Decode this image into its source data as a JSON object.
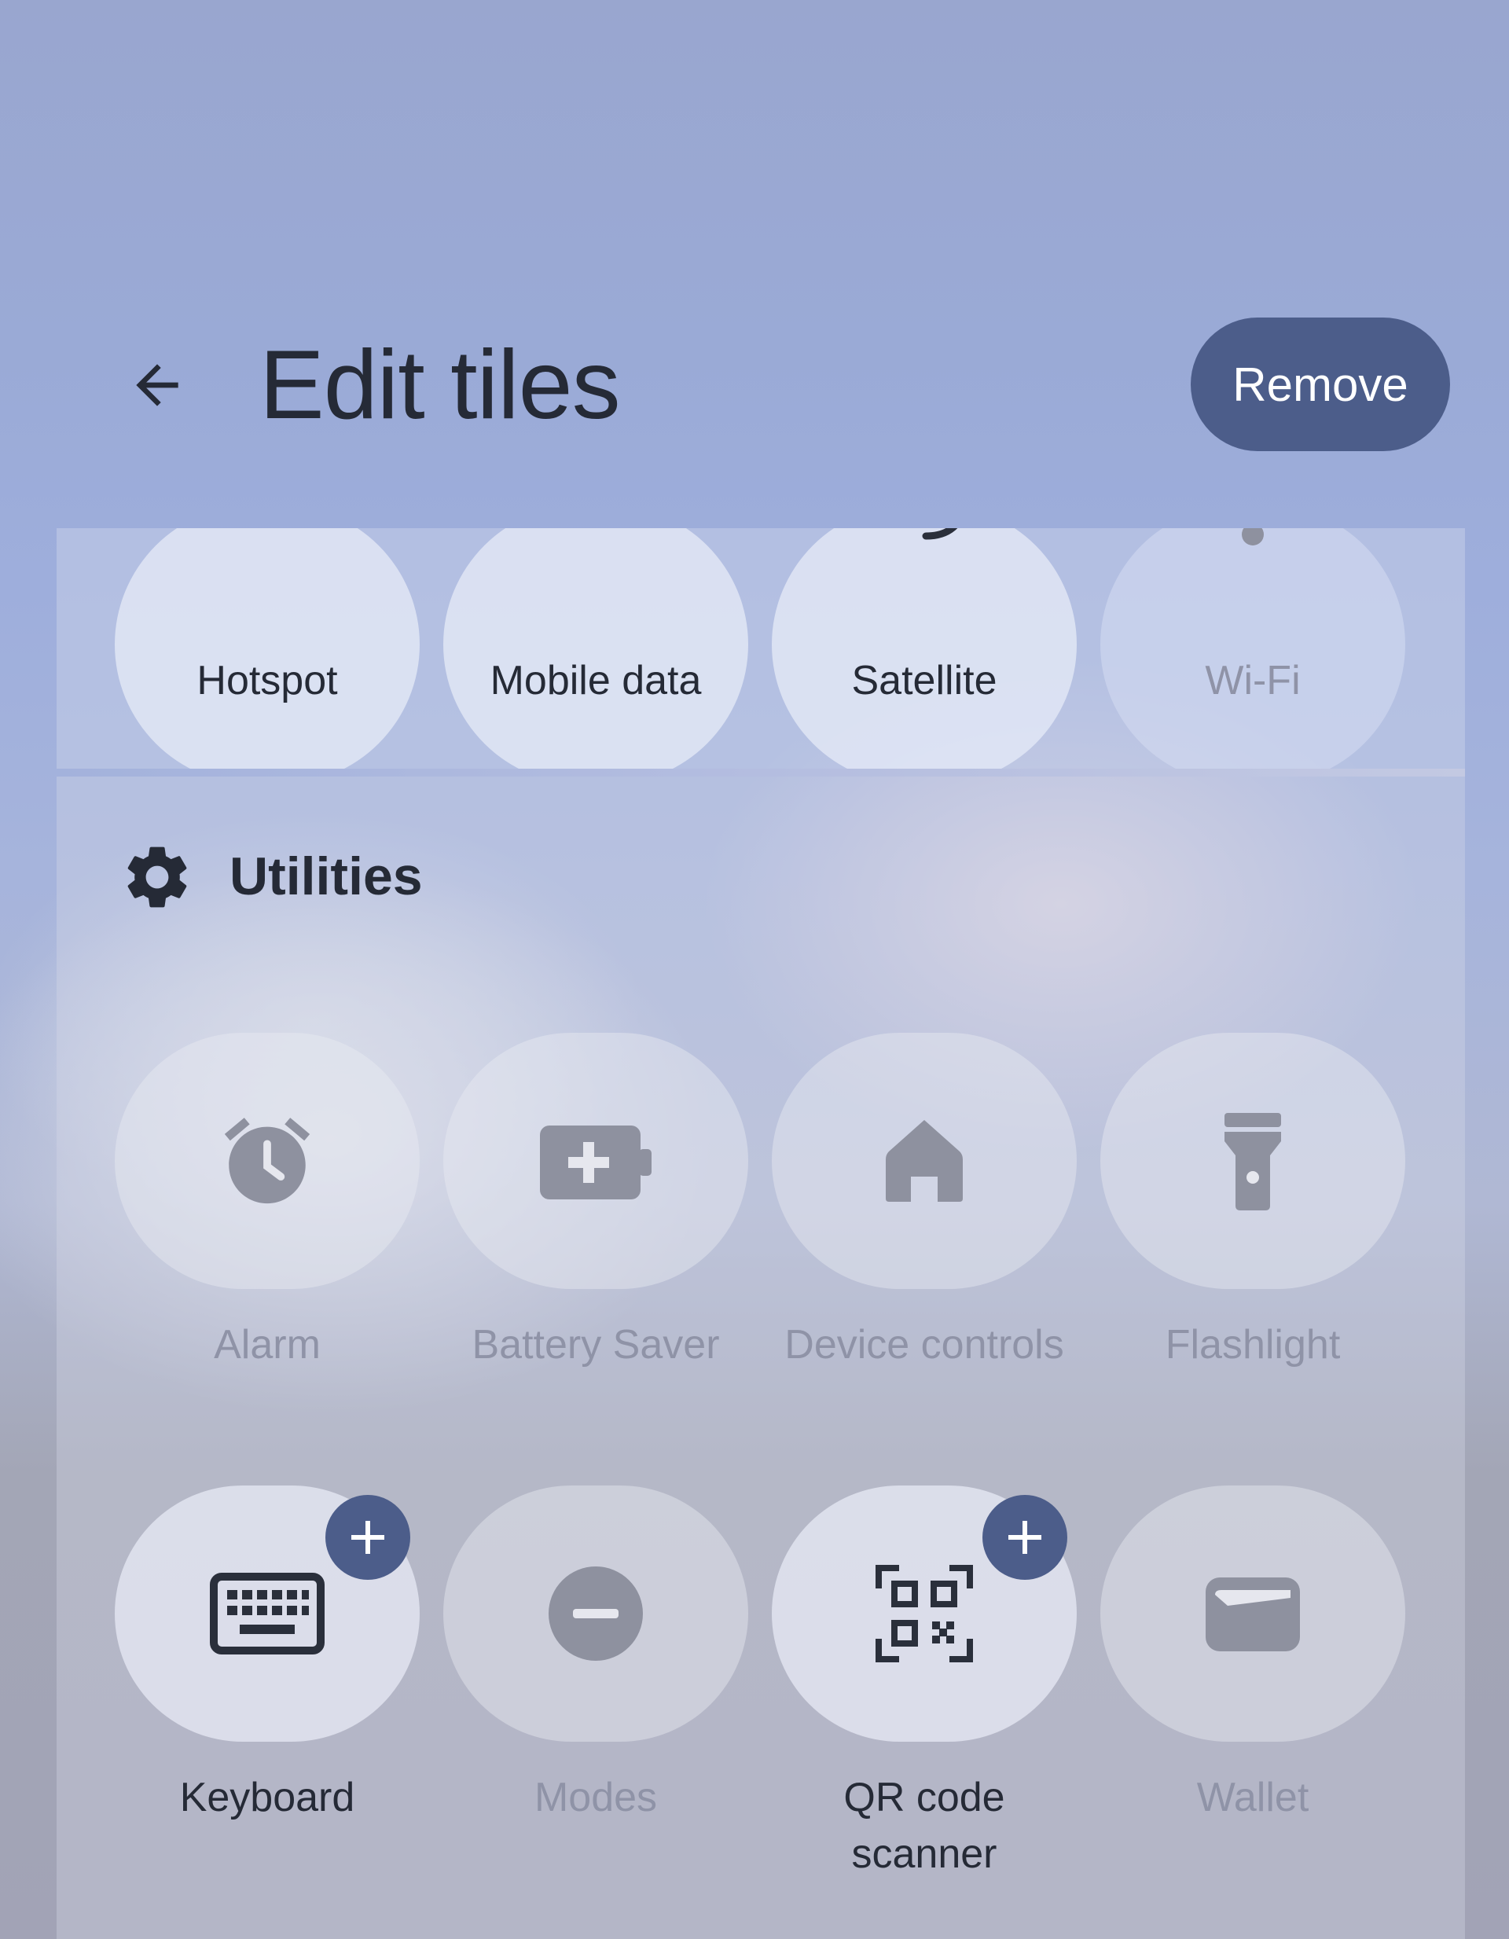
{
  "header": {
    "title": "Edit tiles",
    "remove_label": "Remove"
  },
  "connectivity_tiles": [
    {
      "label": "Hotspot",
      "state": "added"
    },
    {
      "label": "Mobile data",
      "state": "added"
    },
    {
      "label": "Satellite",
      "state": "added"
    },
    {
      "label": "Wi-Fi",
      "state": "unavailable"
    }
  ],
  "utilities": {
    "title": "Utilities",
    "icon": "gear-icon",
    "tiles": [
      {
        "label": "Alarm",
        "icon": "alarm-icon",
        "state": "unavailable"
      },
      {
        "label": "Battery Saver",
        "icon": "battery-saver-icon",
        "state": "unavailable"
      },
      {
        "label": "Device controls",
        "icon": "home-icon",
        "state": "unavailable"
      },
      {
        "label": "Flashlight",
        "icon": "flashlight-icon",
        "state": "unavailable"
      },
      {
        "label": "Keyboard",
        "icon": "keyboard-icon",
        "state": "available"
      },
      {
        "label": "Modes",
        "icon": "minus-circle-icon",
        "state": "unavailable"
      },
      {
        "label": "QR code scanner",
        "icon": "qr-code-scanner-icon",
        "state": "available"
      },
      {
        "label": "Wallet",
        "icon": "wallet-icon",
        "state": "unavailable"
      }
    ]
  },
  "colors": {
    "accent": "#4c5d8a",
    "text": "#252a36",
    "dim_text": "#8f93a7",
    "dim_icon": "#8e919f"
  }
}
